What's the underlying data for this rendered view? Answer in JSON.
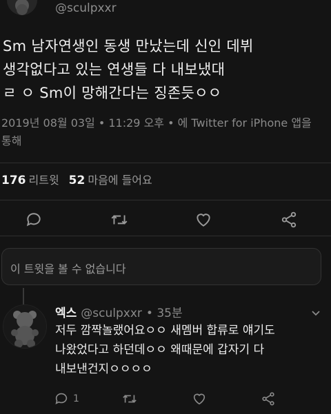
{
  "tweet": {
    "handle": "@sculpxxr",
    "text": "Sm 남자연생인 동생 만났는데 신인 데뷔\n생각없다고 있는 연생들 다 내보냈대\nㄹ ㅇ  Sm이 망해간다는 징존듯ㅇㅇ",
    "meta": "2019년 08월 03일 • 11:29 오후 • 에 Twitter for iPhone 앱을 통해",
    "retweets_count": "176",
    "retweets_label": "리트윗",
    "likes_count": "52",
    "likes_label": "마음에 들어요"
  },
  "unavailable_notice": "이 트윗을 볼 수 없습니다",
  "reply": {
    "name": "엑스",
    "handle": "@sculpxxr",
    "time": "• 35분",
    "text": "저두 깜짝놀랬어요ㅇㅇ 새멤버 합류로 얘기도\n나왔었다고 하던데ㅇㅇ 왜때문에 갑자기 다\n내보낸건지ㅇㅇㅇㅇ",
    "reply_count": "1"
  },
  "icons": {
    "reply": "speech-bubble-icon",
    "retweet": "retweet-arrows-icon",
    "like": "heart-icon",
    "share": "share-icon",
    "caret": "chevron-down-icon"
  },
  "colors": {
    "background": "#141414",
    "text": "#ededed",
    "muted": "#8a8a8a"
  }
}
